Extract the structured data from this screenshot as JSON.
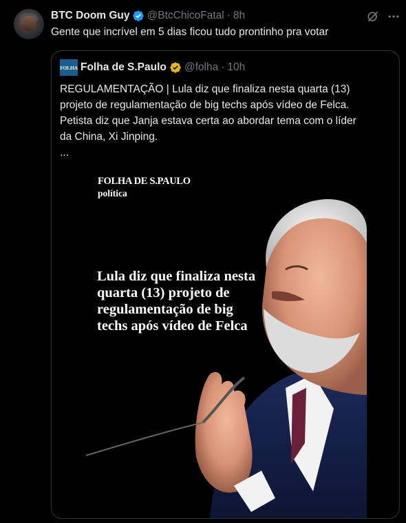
{
  "tweet": {
    "display_name": "BTC Doom Guy",
    "handle": "@BtcChicoFatal",
    "separator": "·",
    "time": "8h",
    "text": "Gente que incrível em 5 dias ficou tudo prontinho pra votar",
    "icons": {
      "verified": "verified-badge-icon",
      "grok": "grok-icon",
      "more": "more-icon"
    }
  },
  "quote": {
    "logo_text": "FOLHA",
    "display_name": "Folha de S.Paulo",
    "handle": "@folha",
    "separator": "·",
    "time": "10h",
    "text_lines": [
      "REGULAMENTAÇÃO | Lula diz que finaliza nesta quarta (13)",
      "projeto de regulamentação de big techs após vídeo de Felca.",
      "Petista diz que Janja estava certa ao abordar tema com o líder",
      "da China, Xi Jinping.",
      "..."
    ],
    "media": {
      "brand": "FOLHA DE S.PAULO",
      "section": "política",
      "headline_lines": [
        "Lula diz que finaliza nesta",
        "quarta (13) projeto de",
        "regulamentação de big",
        "techs após vídeo de Felca"
      ]
    }
  },
  "colors": {
    "background": "#000000",
    "text": "#e7e9ea",
    "secondary": "#71767b",
    "border": "#2f3336",
    "verified_blue": "#1d9bf0",
    "verified_gold": "#e2b719"
  }
}
